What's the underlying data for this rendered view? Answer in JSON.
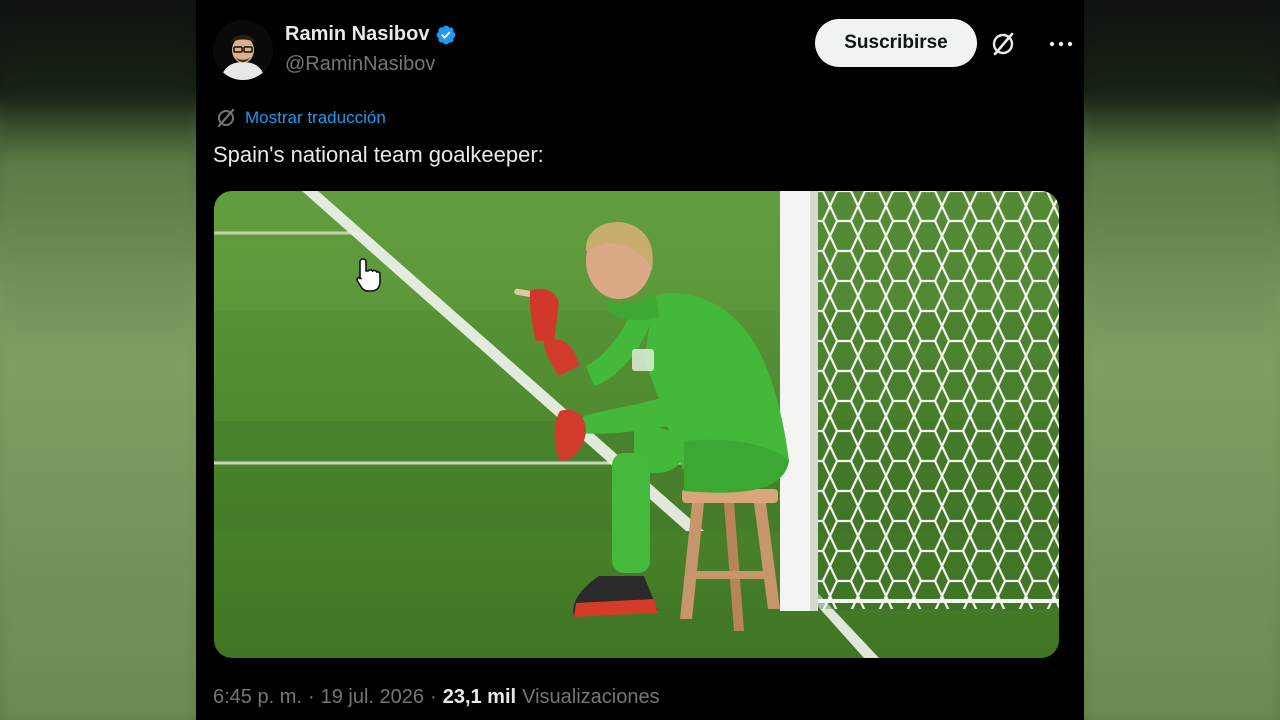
{
  "post": {
    "author": {
      "display_name": "Ramin Nasibov",
      "handle": "@RaminNasibov",
      "verified": true
    },
    "actions": {
      "subscribe_label": "Suscribirse",
      "grok_icon": "grok-icon",
      "more_icon": "more-icon"
    },
    "translate_label": "Mostrar traducción",
    "text": "Spain's national team goalkeeper:",
    "media_alt_description": "",
    "meta": {
      "time": "6:45 p. m.",
      "separator_1": "·",
      "date": "19 jul. 2026",
      "separator_2": "·",
      "views_count": "23,1 mil",
      "views_label": "Visualizaciones"
    }
  },
  "colors": {
    "background": "#000000",
    "text_primary": "#e7e9ea",
    "text_secondary": "#71767b",
    "link": "#1d9bf0",
    "verified": "#1d9bf0",
    "button_bg": "#eff3f4"
  }
}
